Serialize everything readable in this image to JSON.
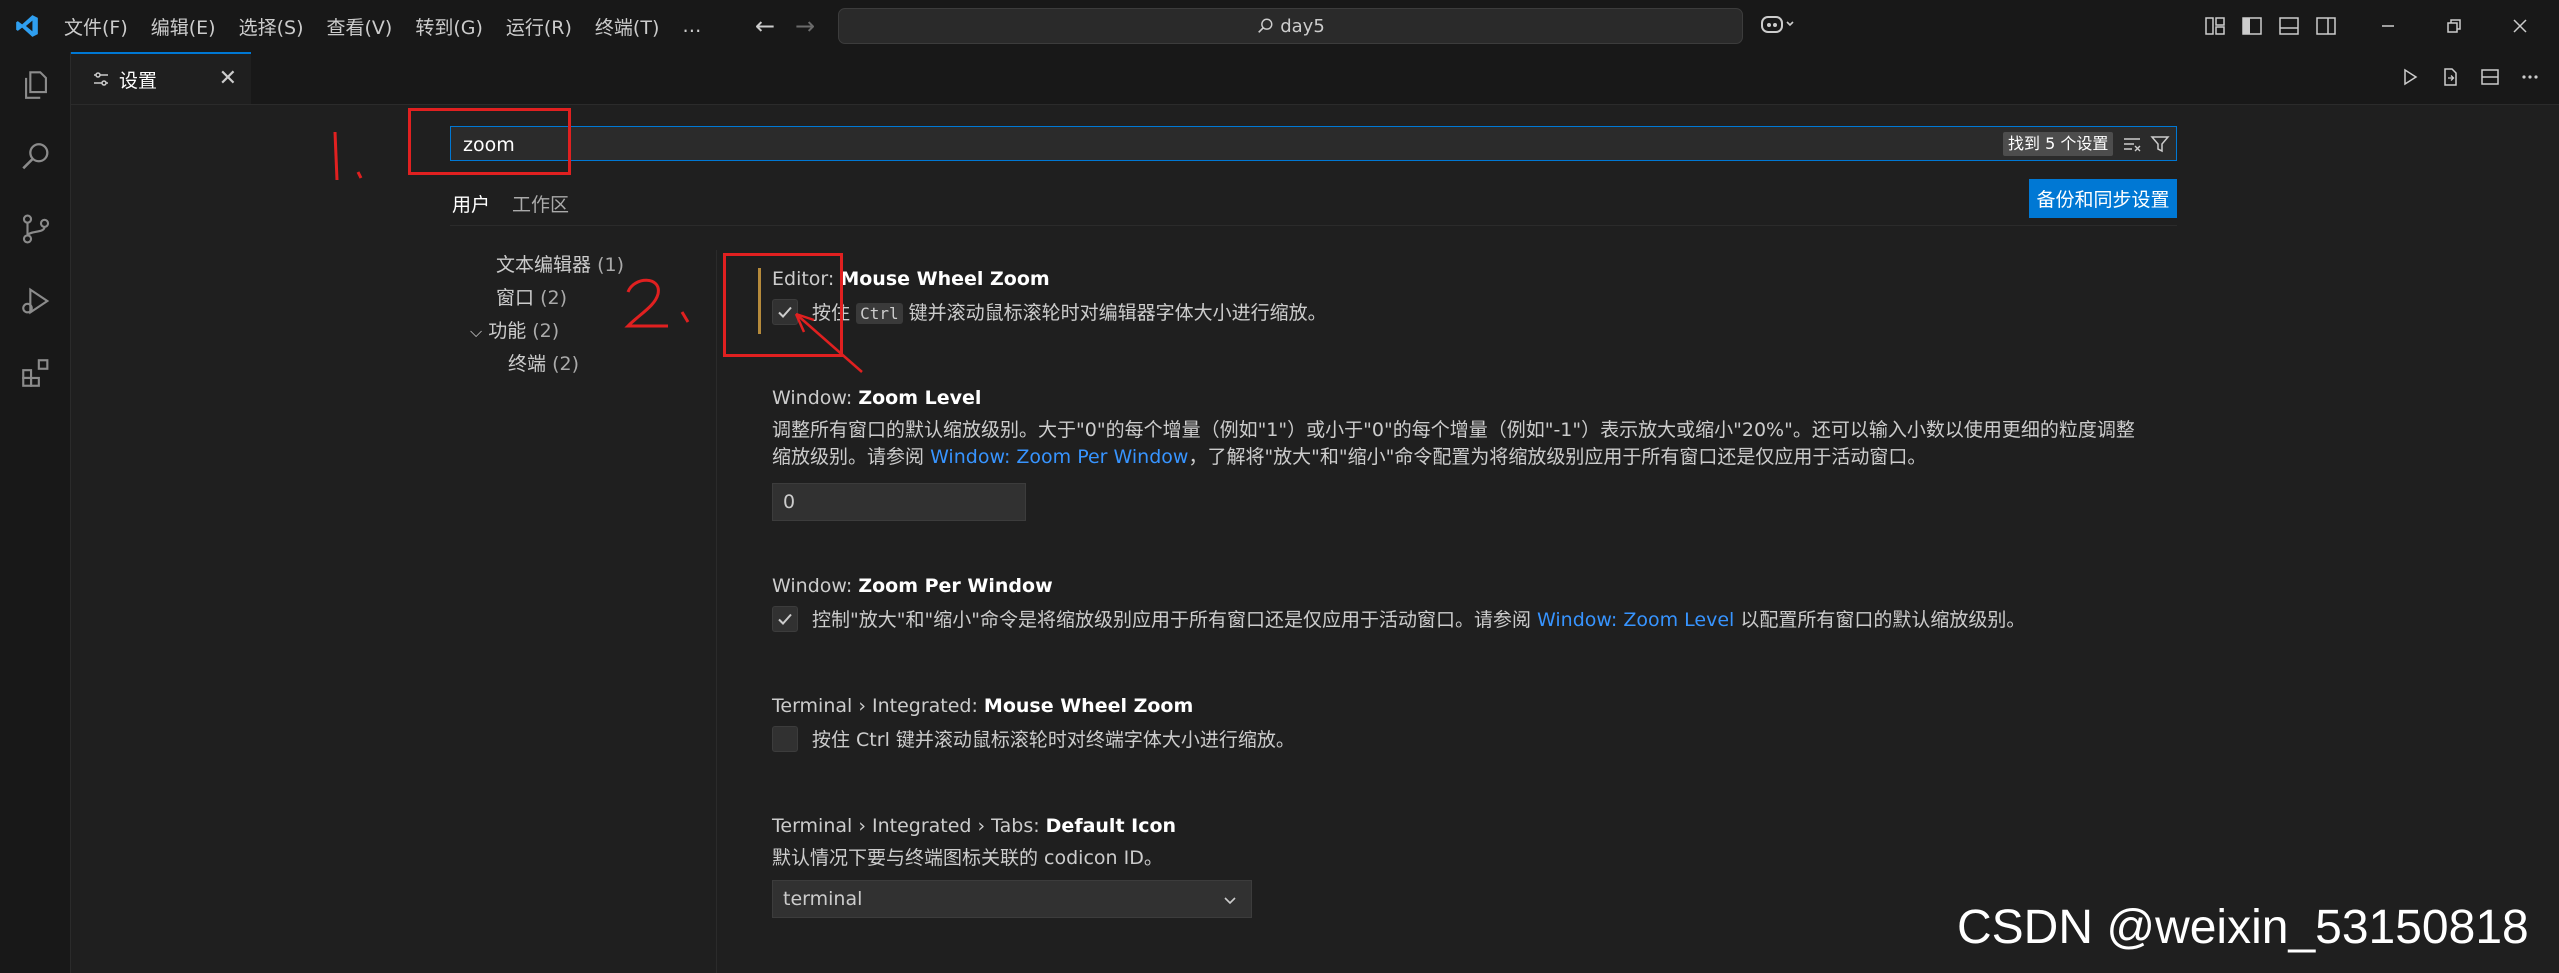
{
  "titlebar": {
    "menus": [
      "文件(F)",
      "编辑(E)",
      "选择(S)",
      "查看(V)",
      "转到(G)",
      "运行(R)",
      "终端(T)",
      "…"
    ],
    "command_center": "day5"
  },
  "tab": {
    "label": "设置"
  },
  "search": {
    "value": "zoom",
    "result_badge": "找到 5 个设置"
  },
  "scopes": {
    "user": "用户",
    "workspace": "工作区"
  },
  "sync_button": "备份和同步设置",
  "toc": [
    {
      "label": "文本编辑器",
      "count": "(1)"
    },
    {
      "label": "窗口",
      "count": "(2)"
    },
    {
      "label": "功能",
      "count": "(2)"
    },
    {
      "label": "终端",
      "count": "(2)"
    }
  ],
  "settings": {
    "s1": {
      "prefix": "Editor: ",
      "name": "Mouse Wheel Zoom",
      "desc_a": "按住",
      "kbd": "Ctrl",
      "desc_b": "键并滚动鼠标滚轮时对编辑器字体大小进行缩放。",
      "checked": true
    },
    "s2": {
      "prefix": "Window: ",
      "name": "Zoom Level",
      "desc_1": "调整所有窗口的默认缩放级别。大于\"0\"的每个增量（例如\"1\"）或小于\"0\"的每个增量（例如\"-1\"）表示放大或缩小\"20%\"。还可以输入小数以使用更细的粒度调整",
      "desc_2a": "缩放级别。请参阅",
      "desc_link": "Window: Zoom Per Window",
      "desc_2b": "，了解将\"放大\"和\"缩小\"命令配置为将缩放级别应用于所有窗口还是仅应用于活动窗口。",
      "value": "0"
    },
    "s3": {
      "prefix": "Window: ",
      "name": "Zoom Per Window",
      "desc_a": "控制\"放大\"和\"缩小\"命令是将缩放级别应用于所有窗口还是仅应用于活动窗口。请参阅",
      "desc_link": "Window: Zoom Level",
      "desc_b": "以配置所有窗口的默认缩放级别。",
      "checked": true
    },
    "s4": {
      "prefix": "Terminal › Integrated: ",
      "name": "Mouse Wheel Zoom",
      "desc": "按住 Ctrl 键并滚动鼠标滚轮时对终端字体大小进行缩放。",
      "checked": false
    },
    "s5": {
      "prefix": "Terminal › Integrated › Tabs: ",
      "name": "Default Icon",
      "desc": "默认情况下要与终端图标关联的 codicon ID。",
      "value": "terminal"
    }
  },
  "annotations": {
    "step1": "1、",
    "step2": "2、"
  },
  "watermark": "CSDN @weixin_53150818",
  "colors": {
    "accent": "#0078d4",
    "link": "#3794ff",
    "annotation": "#e02020",
    "modified_bar": "#b58a3b"
  }
}
